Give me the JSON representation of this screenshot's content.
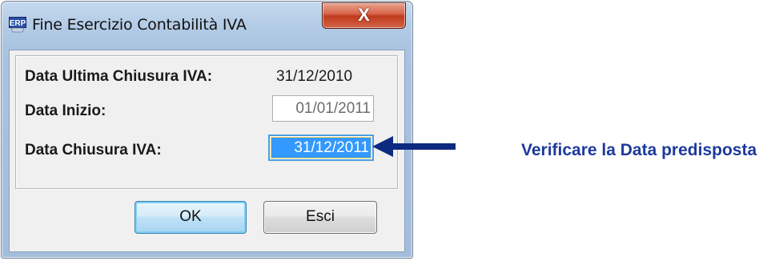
{
  "window": {
    "title": "Fine Esercizio Contabilità IVA",
    "icon": "erp-app-icon",
    "close_label": "X"
  },
  "form": {
    "ultima_chiusura": {
      "label": "Data Ultima Chiusura IVA:",
      "value": "31/12/2010"
    },
    "data_inizio": {
      "label": "Data Inizio:",
      "value": "01/01/2011"
    },
    "data_chiusura": {
      "label": "Data Chiusura IVA:",
      "value": "31/12/2011"
    }
  },
  "buttons": {
    "ok": "OK",
    "esci": "Esci"
  },
  "annotation": {
    "text": "Verificare la Data predisposta",
    "color": "#1d3a9c",
    "arrow_color": "#0d2a80"
  },
  "colors": {
    "selection": "#3399ff",
    "focus_border": "#4c9de0",
    "close_button": "#c13a1d"
  }
}
